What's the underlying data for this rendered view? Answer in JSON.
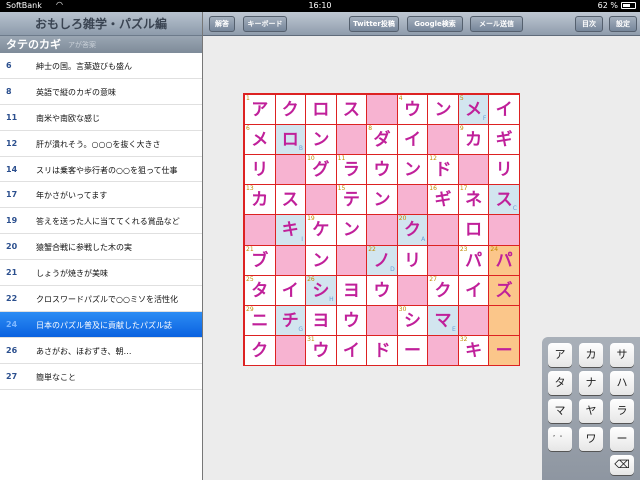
{
  "status_bar": {
    "carrier": "SoftBank",
    "time": "16:10",
    "battery": "62 %"
  },
  "sidebar": {
    "title": "おもしろ雑学・パズル編",
    "section": "タテのカギ",
    "section_sub": "アが答案",
    "clues": [
      {
        "num": "6",
        "text": "紳士の国。言葉遊びも盛ん"
      },
      {
        "num": "8",
        "text": "英語で縦のカギの意味"
      },
      {
        "num": "11",
        "text": "南米や南欧な感じ"
      },
      {
        "num": "12",
        "text": "肝が潰れそう。○○○を抜く大きさ"
      },
      {
        "num": "14",
        "text": "スリは乗客や歩行者の○○を狙って仕事"
      },
      {
        "num": "17",
        "text": "年かさがいってます"
      },
      {
        "num": "19",
        "text": "答えを送った人に当ててくれる賞品など"
      },
      {
        "num": "20",
        "text": "猿蟹合戦に参戦した木の実"
      },
      {
        "num": "21",
        "text": "しょうが焼きが美味"
      },
      {
        "num": "22",
        "text": "クロスワードパズルで○○ミソを活性化"
      },
      {
        "num": "24",
        "text": "日本のパズル普及に貢献したパズル誌",
        "selected": true
      },
      {
        "num": "26",
        "text": "あさがお、ほおずき、朝…"
      },
      {
        "num": "27",
        "text": "簡単なこと"
      }
    ]
  },
  "toolbar": {
    "answer": "解答",
    "keyboard": "キーボード",
    "twitter": "Twitter投稿",
    "google": "Google検索",
    "mail": "メール送信",
    "index": "目次",
    "settings": "設定"
  },
  "grid": {
    "rows": [
      [
        "ア",
        "ク",
        "ロ",
        "ス",
        "#",
        "ウ",
        "ン",
        "メ",
        "イ"
      ],
      [
        "メ",
        "ロ",
        "ン",
        "#",
        "ダ",
        "イ",
        "#",
        "カ",
        "ギ"
      ],
      [
        "リ",
        "#",
        "グ",
        "ラ",
        "ウ",
        "ン",
        "ド",
        "#",
        "リ"
      ],
      [
        "カ",
        "ス",
        "#",
        "テ",
        "ン",
        "#",
        "ギ",
        "ネ",
        "ス"
      ],
      [
        "#",
        "キ",
        "ケ",
        "ン",
        "#",
        "ク",
        "#",
        "ロ",
        "#"
      ],
      [
        "ブ",
        "#",
        "ン",
        "#",
        "ノ",
        "リ",
        "#",
        "パ",
        "パ"
      ],
      [
        "タ",
        "イ",
        "シ",
        "ヨ",
        "ウ",
        "#",
        "ク",
        "イ",
        "ズ"
      ],
      [
        "ニ",
        "チ",
        "ヨ",
        "ウ",
        "#",
        "シ",
        "マ",
        "#",
        ""
      ],
      [
        "ク",
        "#",
        "ウ",
        "イ",
        "ド",
        "ー",
        "#",
        "キ",
        "ー"
      ]
    ],
    "numbers": [
      {
        "r": 0,
        "c": 0,
        "n": "1"
      },
      {
        "r": 0,
        "c": 5,
        "n": "4"
      },
      {
        "r": 0,
        "c": 7,
        "n": "5"
      },
      {
        "r": 1,
        "c": 0,
        "n": "6"
      },
      {
        "r": 1,
        "c": 4,
        "n": "8"
      },
      {
        "r": 1,
        "c": 7,
        "n": "9"
      },
      {
        "r": 2,
        "c": 2,
        "n": "10"
      },
      {
        "r": 2,
        "c": 3,
        "n": "11"
      },
      {
        "r": 2,
        "c": 6,
        "n": "12"
      },
      {
        "r": 3,
        "c": 0,
        "n": "13"
      },
      {
        "r": 3,
        "c": 3,
        "n": "15"
      },
      {
        "r": 3,
        "c": 6,
        "n": "16"
      },
      {
        "r": 3,
        "c": 7,
        "n": "17"
      },
      {
        "r": 4,
        "c": 2,
        "n": "19"
      },
      {
        "r": 4,
        "c": 5,
        "n": "20"
      },
      {
        "r": 5,
        "c": 0,
        "n": "21"
      },
      {
        "r": 5,
        "c": 4,
        "n": "22"
      },
      {
        "r": 5,
        "c": 7,
        "n": "23"
      },
      {
        "r": 5,
        "c": 8,
        "n": "24"
      },
      {
        "r": 6,
        "c": 0,
        "n": "25"
      },
      {
        "r": 6,
        "c": 2,
        "n": "26"
      },
      {
        "r": 6,
        "c": 6,
        "n": "27"
      },
      {
        "r": 7,
        "c": 0,
        "n": "29"
      },
      {
        "r": 7,
        "c": 5,
        "n": "30"
      },
      {
        "r": 8,
        "c": 2,
        "n": "31"
      },
      {
        "r": 8,
        "c": 7,
        "n": "32"
      }
    ],
    "letters": [
      {
        "r": 0,
        "c": 7,
        "l": "F"
      },
      {
        "r": 1,
        "c": 1,
        "l": "B"
      },
      {
        "r": 3,
        "c": 8,
        "l": "C"
      },
      {
        "r": 4,
        "c": 1,
        "l": "I"
      },
      {
        "r": 4,
        "c": 5,
        "l": "A"
      },
      {
        "r": 5,
        "c": 4,
        "l": "D"
      },
      {
        "r": 6,
        "c": 2,
        "l": "H"
      },
      {
        "r": 7,
        "c": 1,
        "l": "G"
      },
      {
        "r": 7,
        "c": 6,
        "l": "E"
      }
    ],
    "highlight_cells": [
      {
        "r": 0,
        "c": 7
      },
      {
        "r": 1,
        "c": 1
      },
      {
        "r": 3,
        "c": 8
      },
      {
        "r": 4,
        "c": 1
      },
      {
        "r": 4,
        "c": 5
      },
      {
        "r": 5,
        "c": 4
      },
      {
        "r": 6,
        "c": 2
      },
      {
        "r": 7,
        "c": 1
      },
      {
        "r": 7,
        "c": 6
      }
    ],
    "selected_column": 8,
    "selected_rows": [
      5,
      6,
      7,
      8
    ],
    "colors": {
      "block": "#f7b3d1",
      "highlight": "#d2e5ef",
      "selected": "#fbc68a",
      "letter": "#c0209a"
    }
  },
  "keyboard": {
    "keys": [
      [
        "ア",
        "カ",
        "サ"
      ],
      [
        "タ",
        "ナ",
        "ハ"
      ],
      [
        "マ",
        "ヤ",
        "ラ"
      ],
      [
        "゛゜",
        "ワ",
        "ー"
      ]
    ],
    "delete_icon": "delete-icon"
  }
}
